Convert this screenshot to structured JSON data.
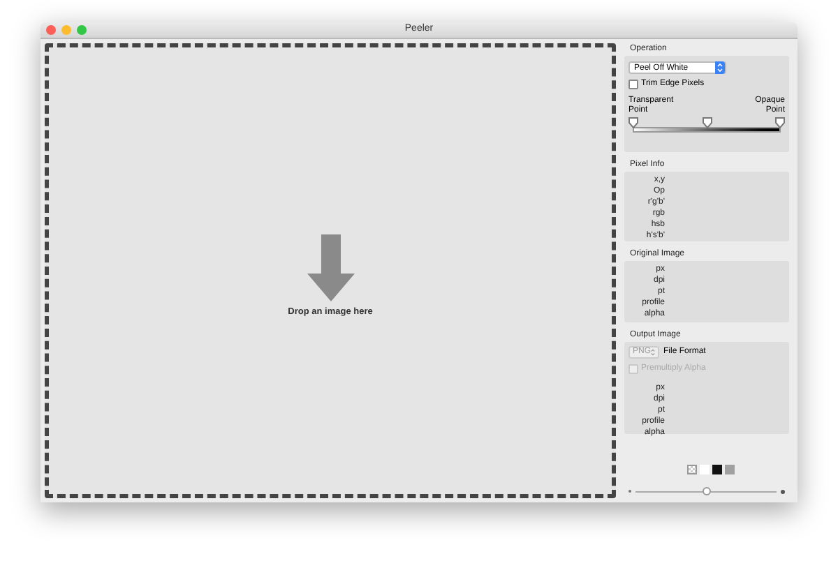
{
  "window": {
    "title": "Peeler"
  },
  "drop_zone": {
    "text": "Drop an image here"
  },
  "operation": {
    "title": "Operation",
    "popup": "Peel Off White",
    "trim": {
      "label": "Trim Edge Pixels",
      "checked": false
    },
    "transparent_label": "Transparent Point",
    "opaque_label": "Opaque Point",
    "thumbs": [
      {
        "level": 0
      },
      {
        "level": 0.5
      },
      {
        "level": 1
      }
    ]
  },
  "pixel_info": {
    "title": "Pixel Info",
    "labels": [
      "x,y",
      "Op",
      "r'g'b'",
      "rgb",
      "hsb",
      "h's'b'"
    ]
  },
  "original_image": {
    "title": "Original Image",
    "labels": [
      "px",
      "dpi",
      "pt",
      "profile",
      "alpha"
    ]
  },
  "output_image": {
    "title": "Output Image",
    "format": "PNG",
    "format_label": "File Format",
    "premultiply": {
      "label": "Premultiply Alpha",
      "checked": false,
      "disabled": true
    },
    "labels": [
      "px",
      "dpi",
      "pt",
      "profile",
      "alpha"
    ]
  },
  "swatches": [
    {
      "kind": "checker"
    },
    {
      "kind": "solid",
      "color": "#ffffff"
    },
    {
      "kind": "solid",
      "color": "#111111"
    },
    {
      "kind": "solid",
      "color": "#a0a0a0"
    }
  ],
  "zoom": {
    "level": 0.5
  }
}
